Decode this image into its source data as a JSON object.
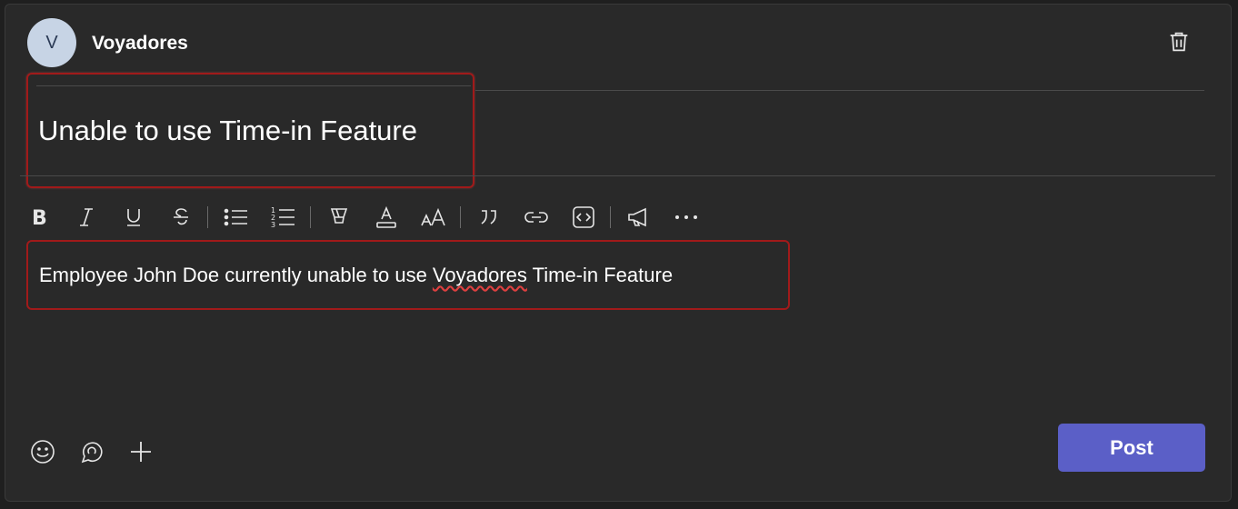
{
  "header": {
    "avatar_initial": "V",
    "team_name": "Voyadores"
  },
  "subject": {
    "text": "Unable to use Time-in Feature"
  },
  "toolbar": {
    "buttons": [
      "bold-icon",
      "italic-icon",
      "underline-icon",
      "strikethrough-icon",
      "bulleted-list-icon",
      "numbered-list-icon",
      "highlight-icon",
      "font-color-icon",
      "font-size-icon",
      "quote-icon",
      "link-icon",
      "code-snippet-icon",
      "announcement-icon",
      "more-options-icon"
    ]
  },
  "body": {
    "text_before": "Employee John Doe currently unable to use ",
    "misspelled_word": "Voyadores",
    "text_after": " Time-in Feature"
  },
  "footer": {
    "post_label": "Post",
    "icons": [
      "emoji-icon",
      "loop-icon",
      "add-icon"
    ]
  },
  "colors": {
    "background": "#292929",
    "accent": "#5b5fc7",
    "highlight_border": "#a11a1a"
  }
}
